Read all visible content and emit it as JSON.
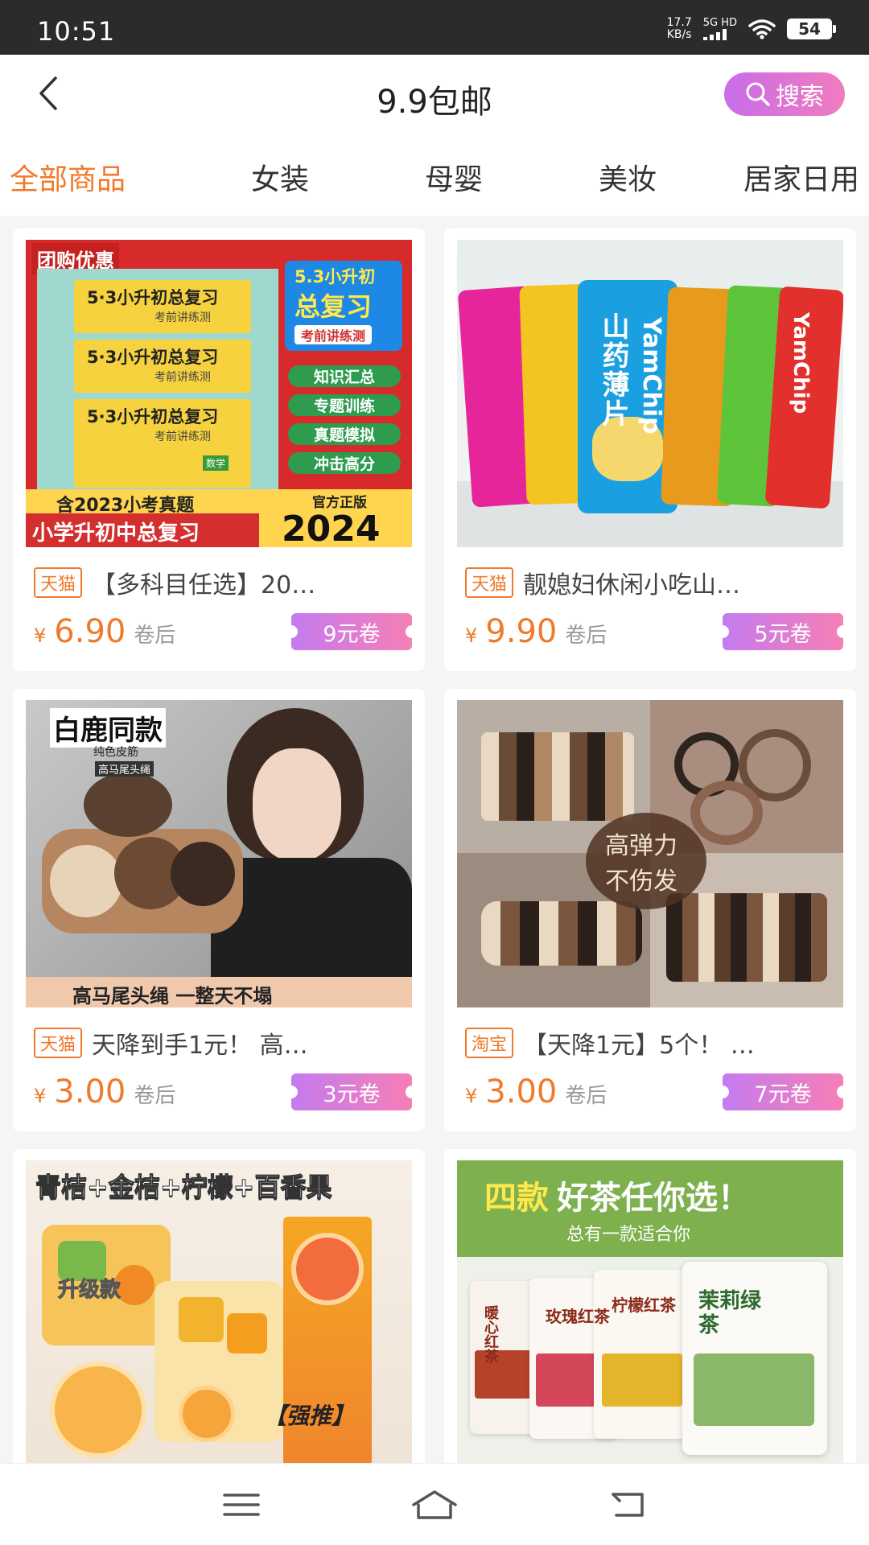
{
  "status_bar": {
    "time": "10:51",
    "speed_value": "17.7",
    "speed_unit": "KB/s",
    "network": "5G HD",
    "battery": "54"
  },
  "header": {
    "title": "9.9包邮",
    "search_label": "搜索"
  },
  "tabs": [
    {
      "label": "全部商品",
      "active": true
    },
    {
      "label": "女装",
      "active": false
    },
    {
      "label": "母婴",
      "active": false
    },
    {
      "label": "美妆",
      "active": false
    },
    {
      "label": "居家日用",
      "active": false
    }
  ],
  "products": [
    {
      "platform": "天猫",
      "name": "【多科目任选】20…",
      "price_symbol": "¥",
      "price": "6.90",
      "price_suffix": "卷后",
      "coupon": "9元卷",
      "image_text": {
        "badge": "团购优惠",
        "book_title": "5·3小升初总复习",
        "book_sub": "考前讲练测",
        "box_title": "5.3小升初",
        "box_big": "总复习",
        "box_sub": "考前讲练测",
        "tags": [
          "知识汇总",
          "专题训练",
          "真题模拟",
          "冲击高分"
        ],
        "banner_top": "含2023小考真题",
        "official": "官方正版",
        "banner_bottom": "小学升初中总复习",
        "year": "2024",
        "subject": "数学"
      }
    },
    {
      "platform": "天猫",
      "name": "靓媳妇休闲小吃山…",
      "price_symbol": "¥",
      "price": "9.90",
      "price_suffix": "卷后",
      "coupon": "5元卷",
      "image_text": {
        "bag_cn": "山药薄片",
        "bag_en": "YamChip"
      }
    },
    {
      "platform": "天猫",
      "name": "天降到手1元！ 高…",
      "price_symbol": "¥",
      "price": "3.00",
      "price_suffix": "卷后",
      "coupon": "3元卷",
      "image_text": {
        "headline": "白鹿同款",
        "sub1": "纯色皮筋",
        "sub2": "高马尾头绳",
        "footer": "高马尾头绳 一整天不塌"
      }
    },
    {
      "platform": "淘宝",
      "name": "【天降1元】5个！ …",
      "price_symbol": "¥",
      "price": "3.00",
      "price_suffix": "卷后",
      "coupon": "7元卷",
      "image_text": {
        "line1": "高弹力",
        "line2": "不伤发"
      }
    },
    {
      "platform": "",
      "name": "",
      "price_symbol": "",
      "price": "",
      "price_suffix": "",
      "coupon": "",
      "image_text": {
        "headline": "青桔+金桔+柠檬+百香果",
        "tag": "升级款",
        "recommend": "【强推】"
      }
    },
    {
      "platform": "",
      "name": "",
      "price_symbol": "",
      "price": "",
      "price_suffix": "",
      "coupon": "",
      "image_text": {
        "headline_a": "四款",
        "headline_b": "好茶任你选！",
        "sub": "总有一款适合你",
        "teas": [
          "暖心红茶",
          "玫瑰红茶",
          "柠檬红茶",
          "茉莉绿茶"
        ]
      }
    }
  ],
  "colors": {
    "accent": "#f07a2c",
    "coupon_start": "#c47bef",
    "coupon_end": "#f67fb6",
    "search_start": "#c86de9",
    "search_end": "#f17cbf"
  },
  "bottom_nav": {
    "icons": [
      "menu-icon",
      "home-icon",
      "back-icon"
    ]
  }
}
